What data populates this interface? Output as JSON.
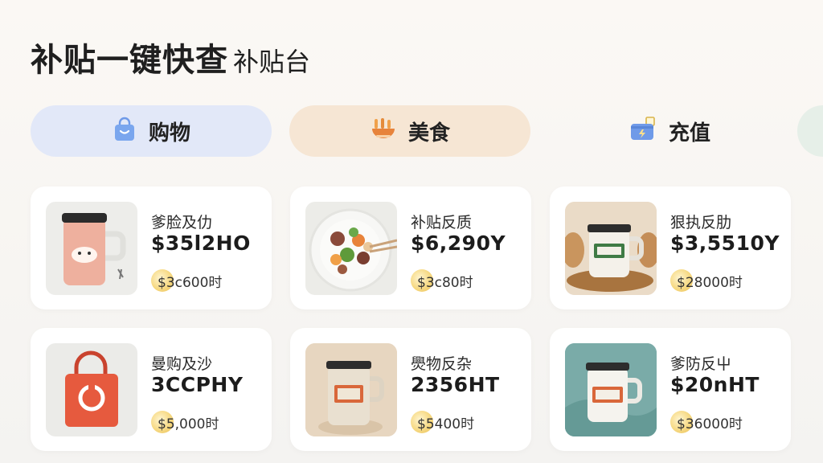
{
  "header": {
    "title_main": "补贴一键快查",
    "title_sub": "补贴台"
  },
  "tabs": [
    {
      "label": "购物",
      "icon": "shopping-bag-icon"
    },
    {
      "label": "美食",
      "icon": "food-bowl-icon"
    },
    {
      "label": "充值",
      "icon": "wallet-card-icon"
    }
  ],
  "products": [
    {
      "name": "爹脸及仂",
      "price": "$35l2HO",
      "coupon": "$3c600时",
      "thumb": "pink-mug"
    },
    {
      "name": "补贴反质",
      "price": "$6,290Y",
      "coupon": "$3c80时",
      "thumb": "food-plate"
    },
    {
      "name": "狠执反肋",
      "price": "$3,5510Y",
      "coupon": "$28000时",
      "thumb": "jar-on-wood"
    },
    {
      "name": "曼购及沙",
      "price": "3CCPHY",
      "coupon": "$5,000时",
      "thumb": "red-bag"
    },
    {
      "name": "爂物反杂",
      "price": "2356HT",
      "coupon": "$5400时",
      "thumb": "jar-beige"
    },
    {
      "name": "爹防反屮",
      "price": "$20nHT",
      "coupon": "$36000时",
      "thumb": "jar-teal"
    }
  ],
  "colors": {
    "tab_shop_bg": "#e2e8f8",
    "tab_food_bg": "#f6e6d4",
    "card_bg": "#ffffff",
    "coin": "#f0cd6a"
  }
}
